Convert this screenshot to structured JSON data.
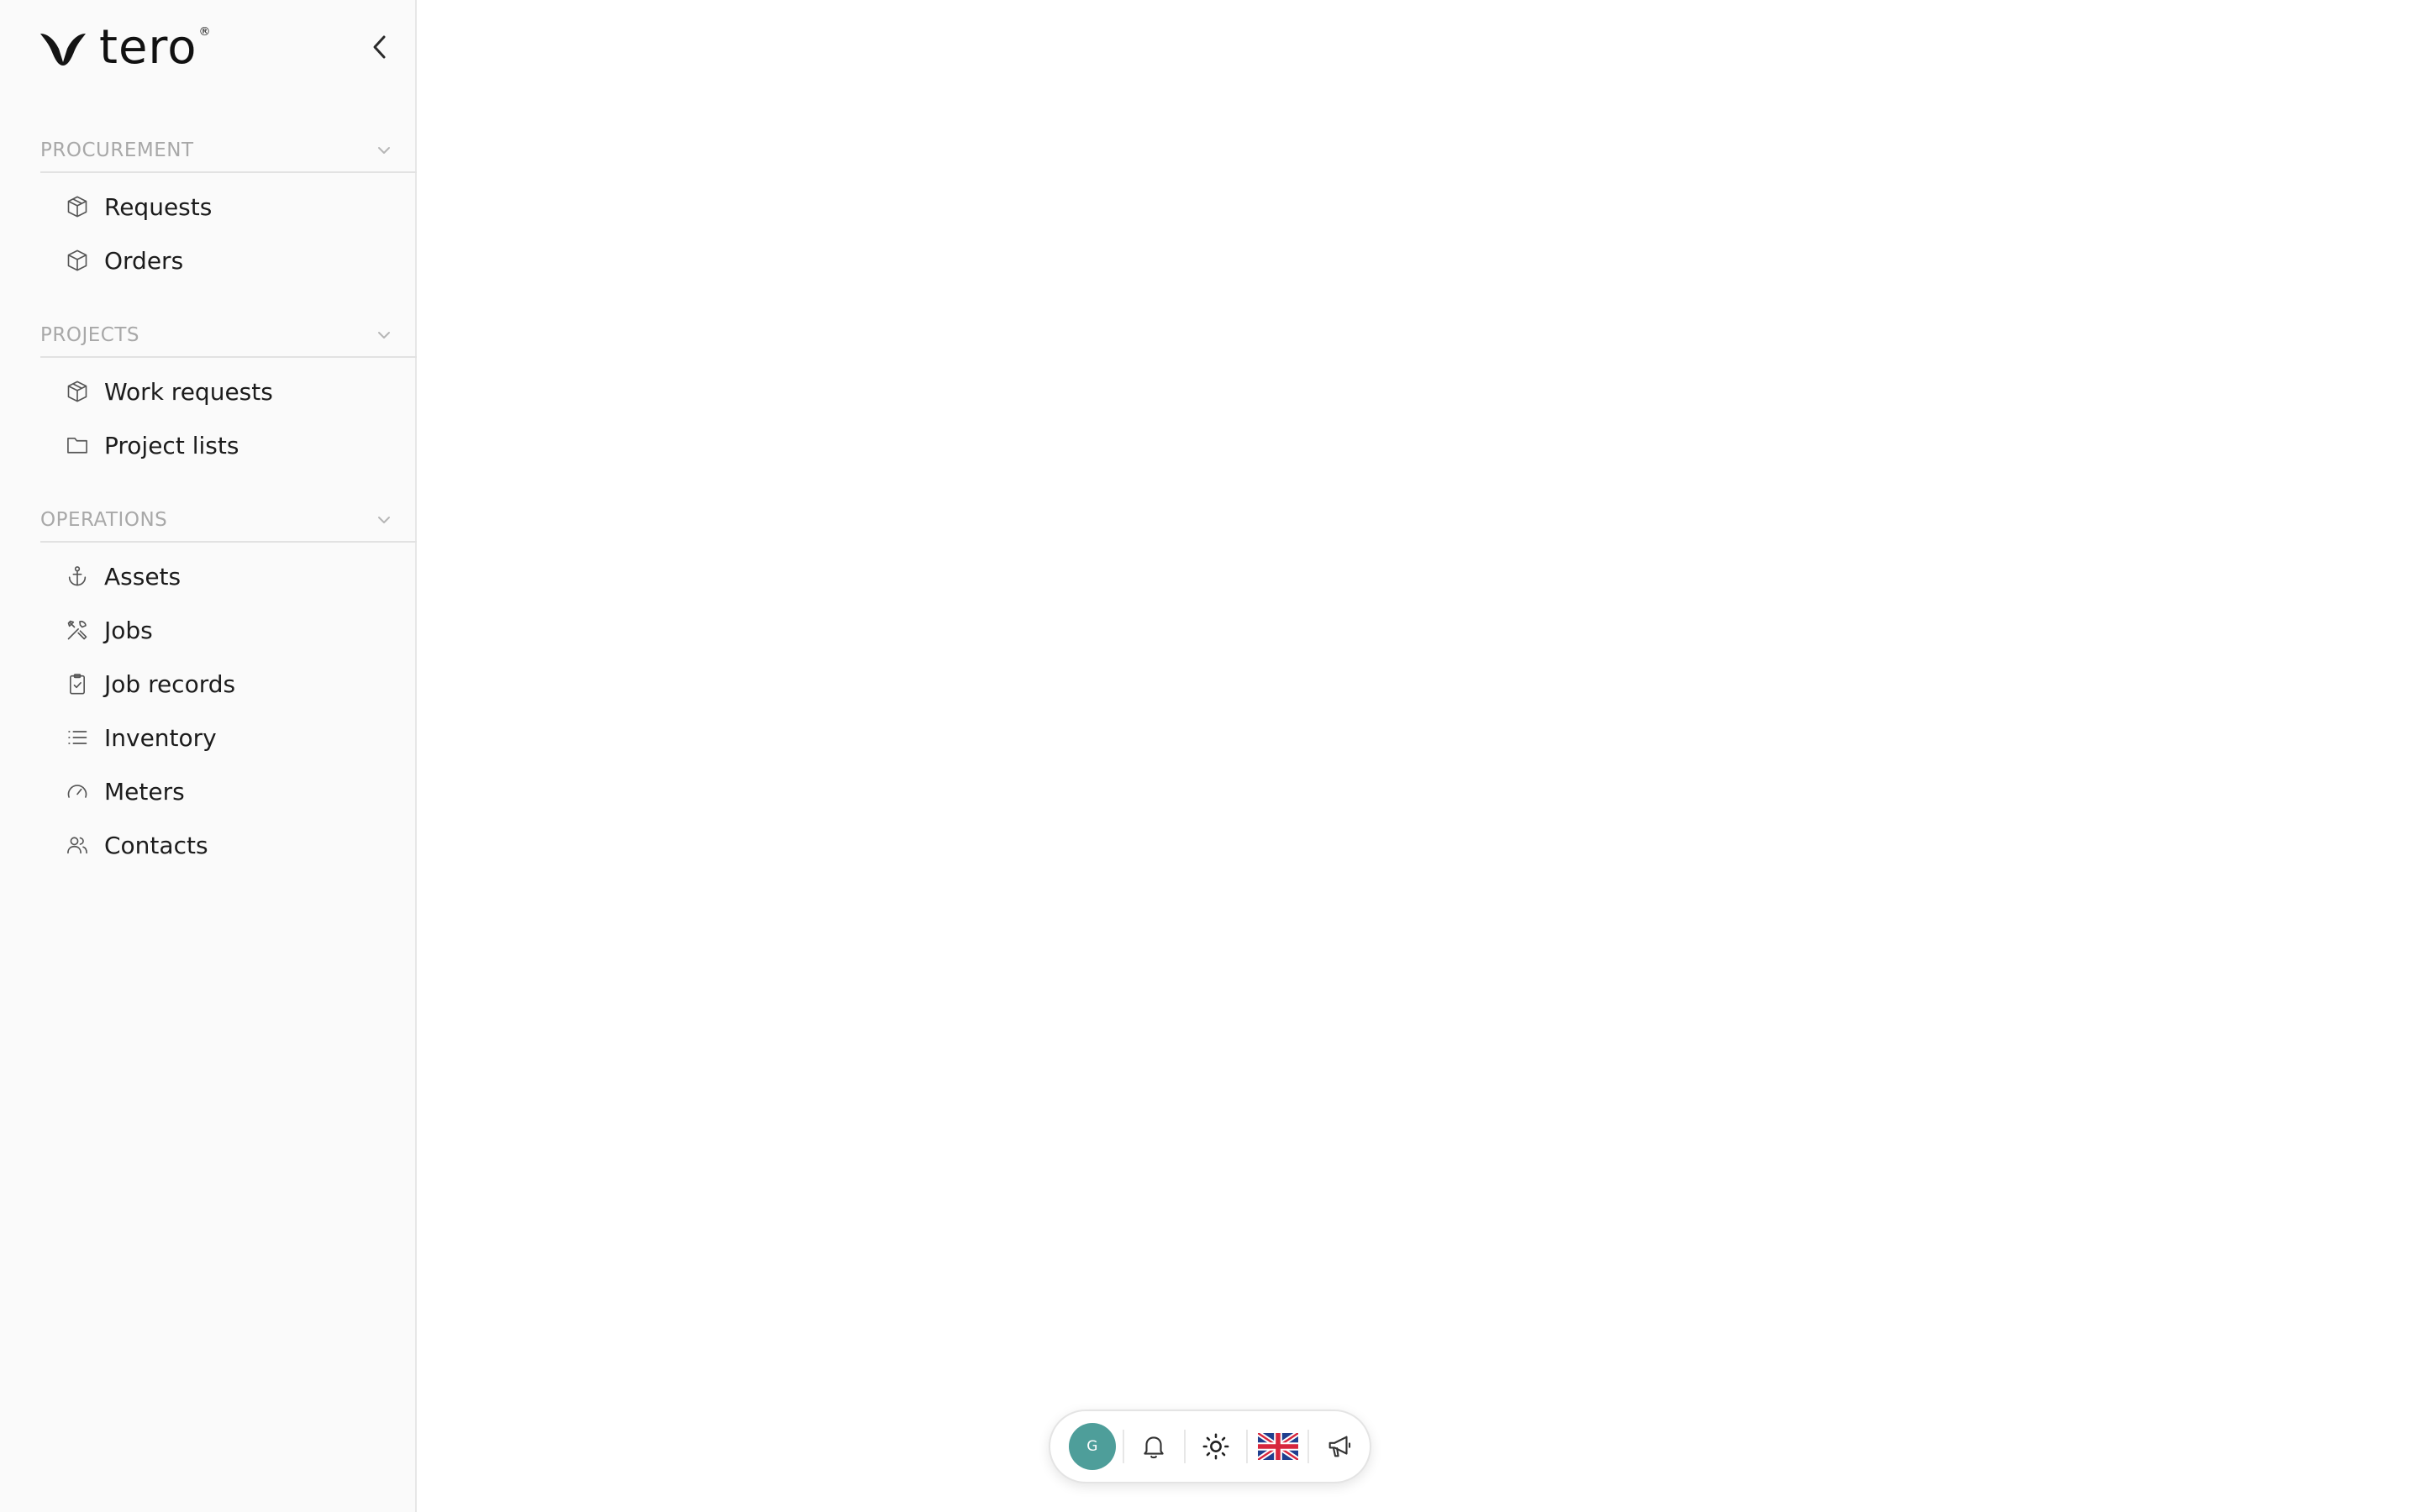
{
  "brand": {
    "name": "tero",
    "registered_mark": "®",
    "color": "#111111"
  },
  "sidebar": {
    "collapse_icon": "chevron-left-icon",
    "sections": [
      {
        "title": "PROCUREMENT",
        "items": [
          {
            "label": "Requests",
            "icon": "box-arrow-icon"
          },
          {
            "label": "Orders",
            "icon": "box-icon"
          }
        ]
      },
      {
        "title": "PROJECTS",
        "items": [
          {
            "label": "Work requests",
            "icon": "box-arrow-icon"
          },
          {
            "label": "Project lists",
            "icon": "folder-icon"
          }
        ]
      },
      {
        "title": "OPERATIONS",
        "items": [
          {
            "label": "Assets",
            "icon": "anchor-icon"
          },
          {
            "label": "Jobs",
            "icon": "tools-icon"
          },
          {
            "label": "Job records",
            "icon": "clipboard-check-icon"
          },
          {
            "label": "Inventory",
            "icon": "list-icon"
          },
          {
            "label": "Meters",
            "icon": "gauge-icon"
          },
          {
            "label": "Contacts",
            "icon": "users-icon"
          }
        ]
      }
    ]
  },
  "dock": {
    "avatar_initial": "G",
    "avatar_color": "#4e9e9a",
    "items": [
      "avatar",
      "bell-icon",
      "sun-icon",
      "uk-flag-icon",
      "megaphone-icon"
    ]
  }
}
